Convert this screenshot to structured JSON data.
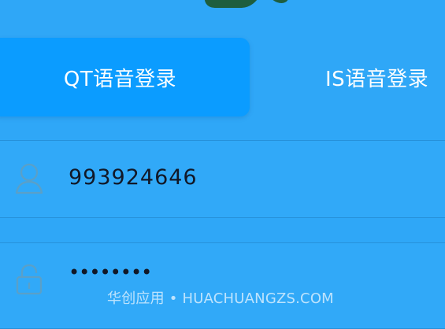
{
  "tabs": [
    {
      "label": "QT语音登录",
      "selected": true
    },
    {
      "label": "IS语音登录",
      "selected": false
    }
  ],
  "account": {
    "value": "993924646",
    "icon": "user-icon"
  },
  "password": {
    "value": "••••••••",
    "icon": "lock-icon"
  },
  "watermark": {
    "text": "华创应用 • HUACHUANGZS.COM"
  },
  "colors": {
    "background": "#2fa7f7",
    "selected_tab": "#0b9cff",
    "text_primary": "#ffffff",
    "field_text": "#111827"
  }
}
